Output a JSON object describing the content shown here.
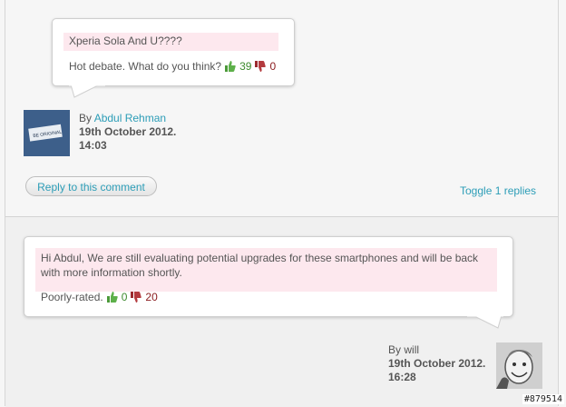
{
  "comments": [
    {
      "title": "Xperia Sola And U????",
      "prompt": "Hot debate. What do you think?",
      "thumbs_up": "39",
      "thumbs_down": "0",
      "by_label": "By",
      "author": "Abdul Rehman",
      "date": "19th October 2012.",
      "time": "14:03",
      "avatar_text": "BE ORIGINAL",
      "reply_label": "Reply to this comment",
      "toggle_label": "Toggle 1 replies"
    },
    {
      "text": "Hi Abdul, We are still evaluating potential upgrades for these smartphones and will be back with more information shortly.",
      "rating_label": "Poorly-rated.",
      "thumbs_up": "0",
      "thumbs_down": "20",
      "by_label": "By",
      "author": "will",
      "date": "19th October 2012.",
      "time": "16:28"
    }
  ],
  "watermark": "#879514",
  "colors": {
    "link": "#2c9db7",
    "up": "#3d8a2e",
    "down": "#8b1d20",
    "highlight": "#fde8ee"
  }
}
